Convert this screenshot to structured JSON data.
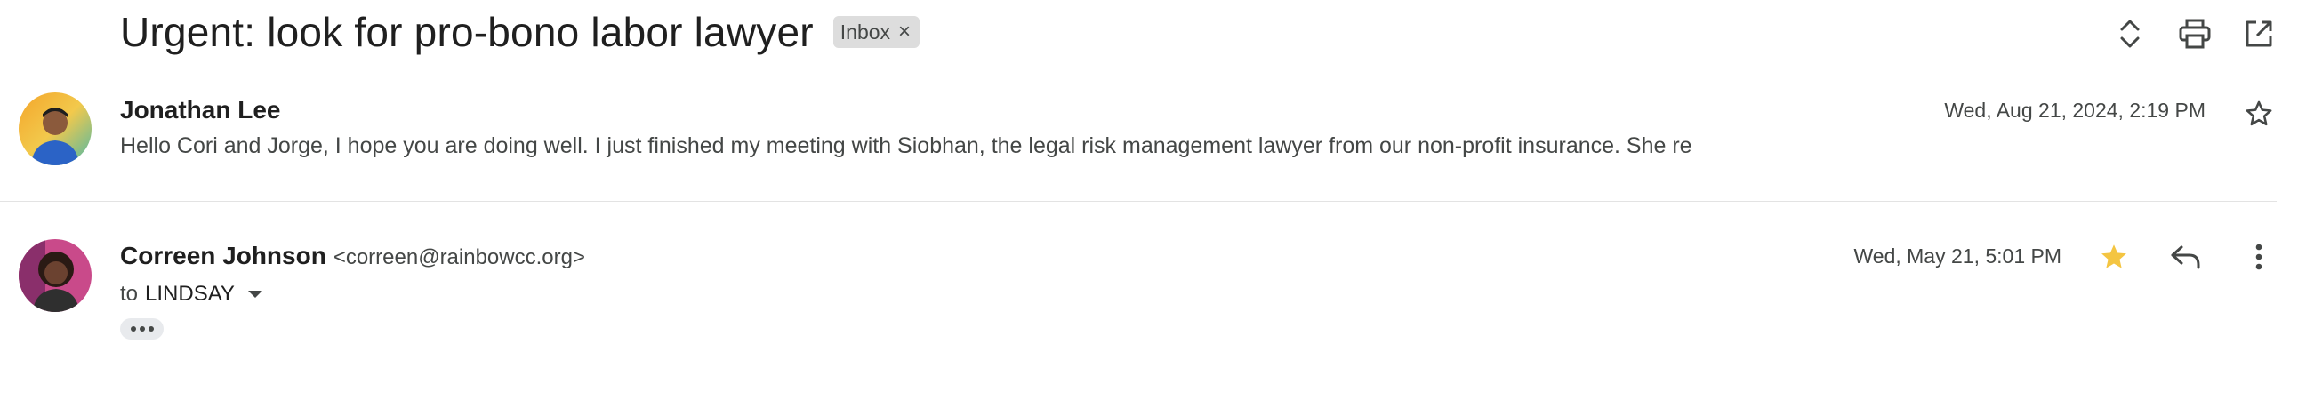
{
  "thread": {
    "subject": "Urgent: look for pro-bono labor lawyer",
    "label": "Inbox",
    "label_remove": "×",
    "header_icons": [
      "expand-collapse-icon",
      "print-icon",
      "open-in-new-window-icon"
    ]
  },
  "messages": [
    {
      "sender_name": "Jonathan Lee",
      "date": "Wed, Aug 21, 2024, 2:19 PM",
      "snippet": "Hello Cori and Jorge, I hope you are doing well. I just finished my meeting with Siobhan, the legal risk management lawyer from our non-profit insurance. She re",
      "starred": false,
      "icons": [
        "star-outline-icon"
      ]
    },
    {
      "sender_name": "Correen Johnson",
      "sender_email": "<correen@rainbowcc.org>",
      "date": "Wed, May 21, 5:01 PM",
      "to_prefix": "to",
      "to_recipient": "LINDSAY",
      "starred": true,
      "icons": [
        "star-filled-icon",
        "reply-icon",
        "more-vert-icon",
        "caret-down-icon",
        "show-trimmed-content-icon"
      ]
    }
  ],
  "colors": {
    "star_filled": "#f4c542",
    "icon": "#444746",
    "divider": "#e3e3e3"
  }
}
